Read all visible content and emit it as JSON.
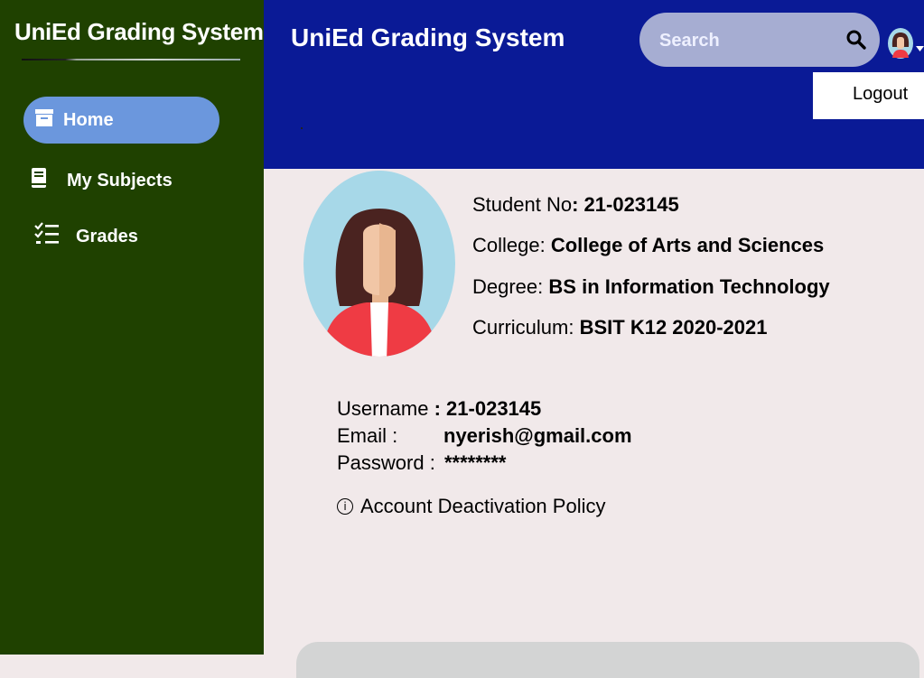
{
  "sidebar": {
    "brand": "UniEd Grading System",
    "items": [
      {
        "label": "Home",
        "icon": "archive-icon",
        "active": true
      },
      {
        "label": "My Subjects",
        "icon": "book-icon",
        "active": false
      },
      {
        "label": "Grades",
        "icon": "checklist-icon",
        "active": false
      }
    ]
  },
  "header": {
    "title": "UniEd Grading System",
    "search_placeholder": "Search",
    "logout_label": "Logout"
  },
  "profile": {
    "student_no_label": "Student No",
    "student_no": "21-023145",
    "college_label": "College:",
    "college": "College of Arts and Sciences",
    "degree_label": "Degree:",
    "degree": "BS in Information Technology",
    "curriculum_label": "Curriculum:",
    "curriculum": "BSIT K12 2020-2021"
  },
  "account": {
    "username_label": "Username",
    "username": "21-023145",
    "email_label": "Email :",
    "email": "nyerish@gmail.com",
    "password_label": "Password :",
    "password": "********",
    "policy_link": "Account Deactivation Policy"
  },
  "colors": {
    "sidebar_bg": "#1f4100",
    "header_bg": "#0a1a96",
    "active_nav": "#6b97dd",
    "content_bg": "#f1e9ea"
  }
}
